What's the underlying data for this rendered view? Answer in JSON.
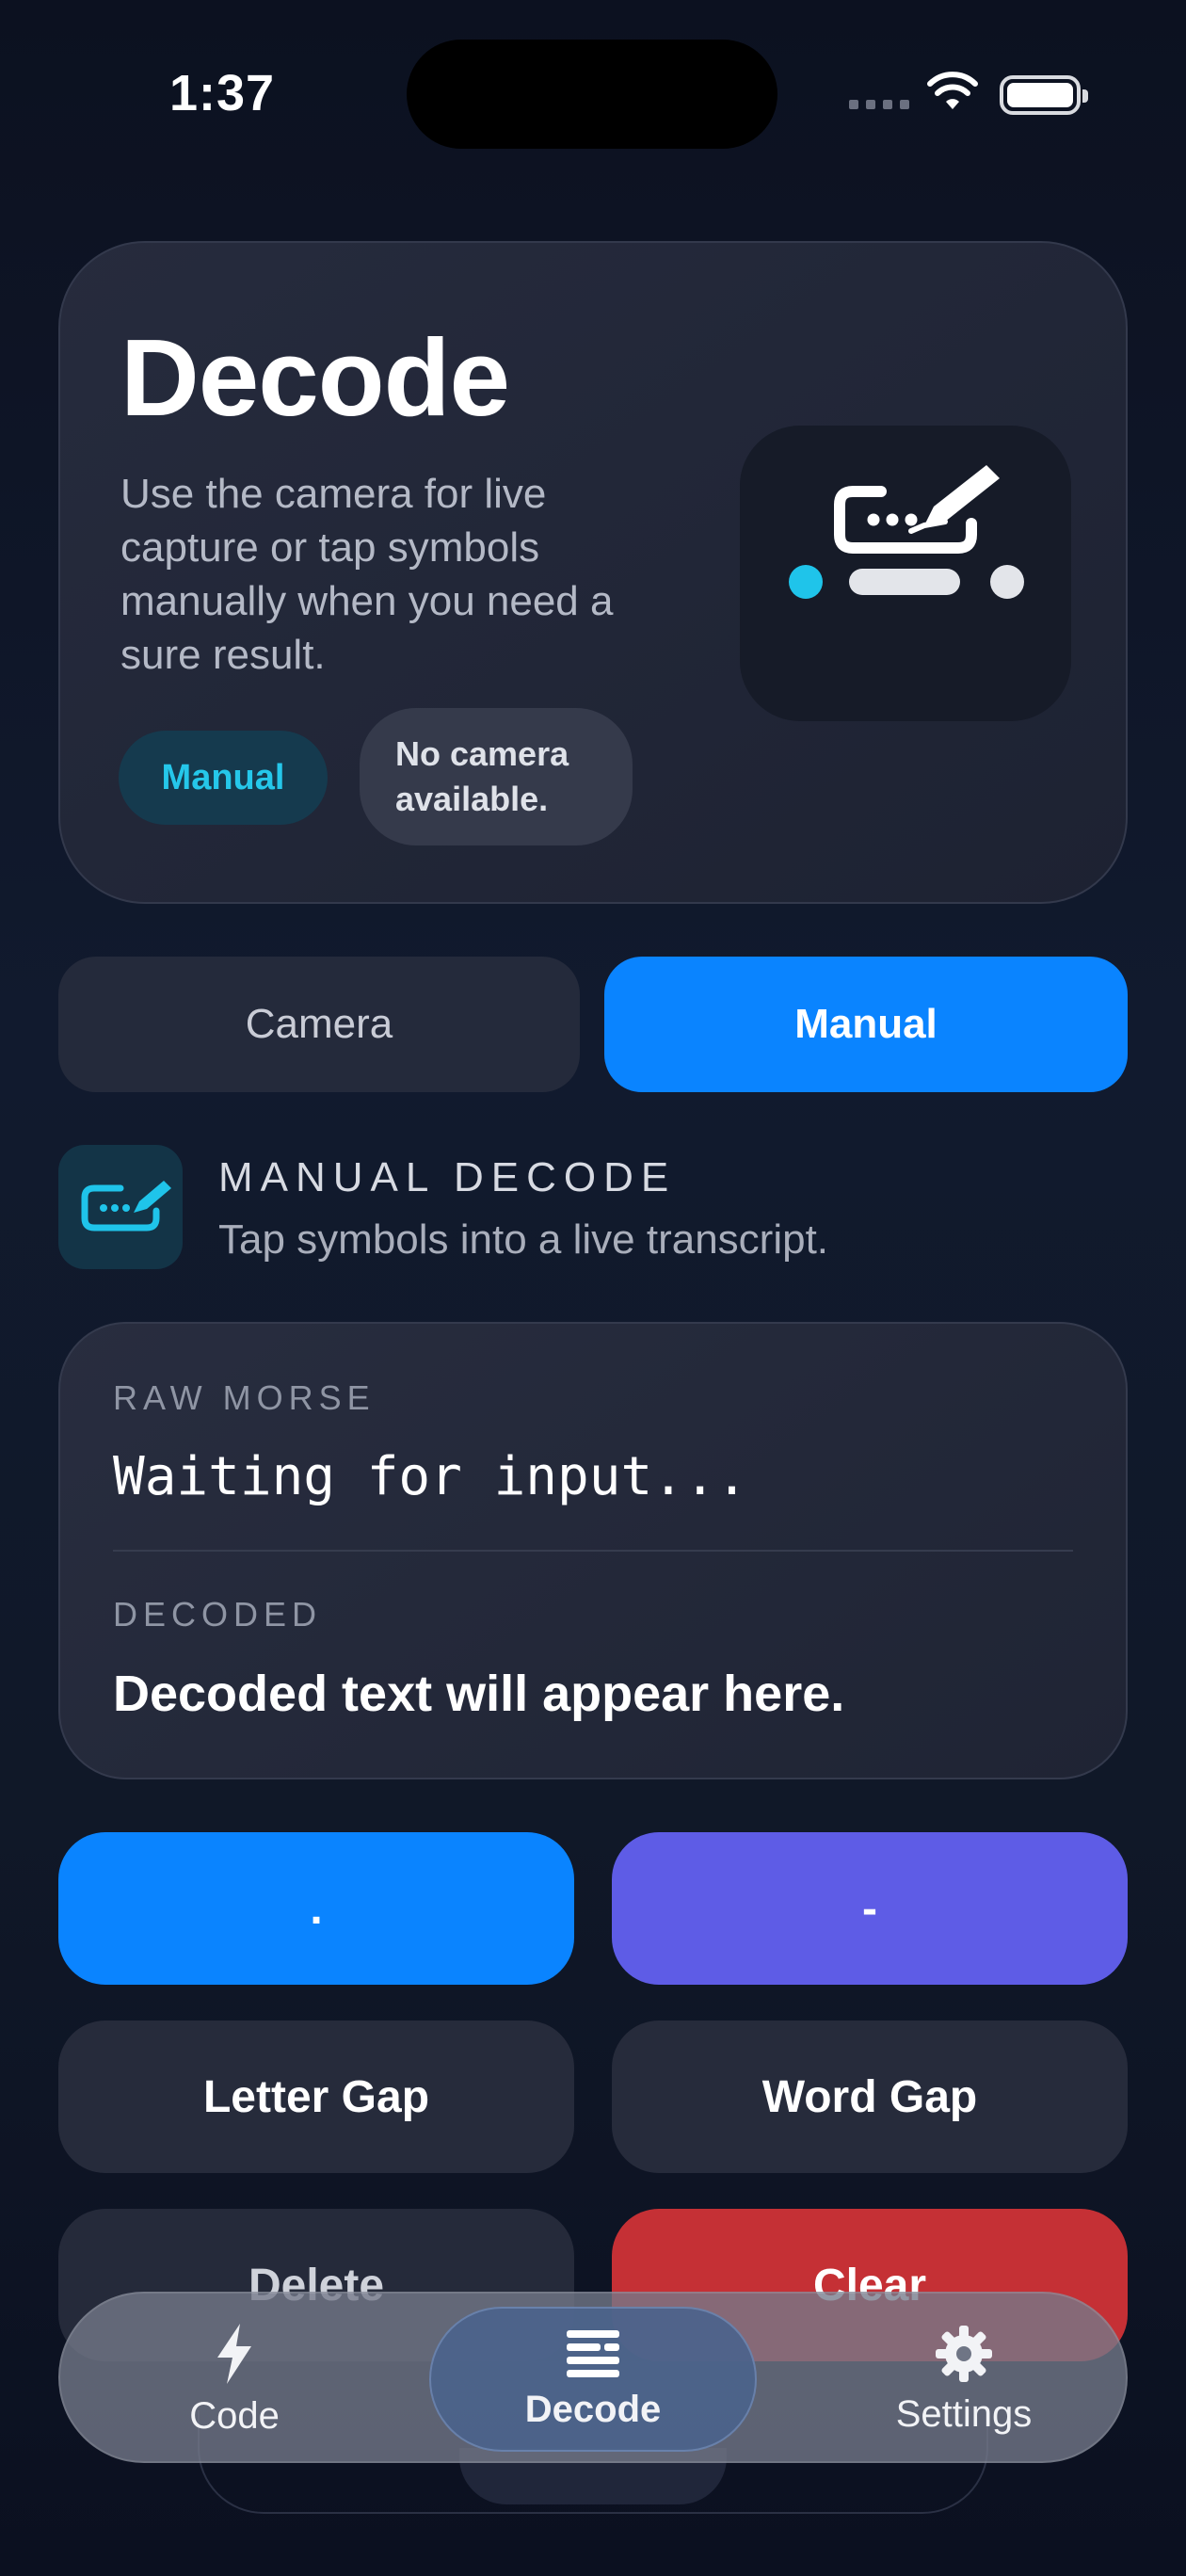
{
  "status_bar": {
    "time": "1:37"
  },
  "hero": {
    "title": "Decode",
    "description": "Use the camera for live capture or tap symbols manually when you need a sure result.",
    "chips": {
      "mode": "Manual",
      "camera_status": "No camera available."
    },
    "art_icon": "keyboard-pencil-icon"
  },
  "segmented": {
    "options": [
      "Camera",
      "Manual"
    ],
    "selected": "Manual"
  },
  "section": {
    "title": "MANUAL DECODE",
    "subtitle": "Tap symbols into a live transcript.",
    "icon": "keyboard-pencil-icon"
  },
  "transcript": {
    "raw_label": "RAW MORSE",
    "raw_value": "Waiting for input...",
    "decoded_label": "DECODED",
    "decoded_value": "Decoded text will appear here."
  },
  "keypad": {
    "dot": ".",
    "dash": "-",
    "letter_gap": "Letter Gap",
    "word_gap": "Word Gap",
    "delete": "Delete",
    "clear": "Clear"
  },
  "tabbar": {
    "items": [
      {
        "label": "Code",
        "icon": "bolt-icon"
      },
      {
        "label": "Decode",
        "icon": "text-lines-icon"
      },
      {
        "label": "Settings",
        "icon": "gear-icon"
      }
    ],
    "selected": "Decode"
  },
  "colors": {
    "accent_blue": "#0a84ff",
    "accent_purple": "#5e5ce6",
    "danger_red": "#c53035",
    "cyan": "#25c7ea"
  }
}
